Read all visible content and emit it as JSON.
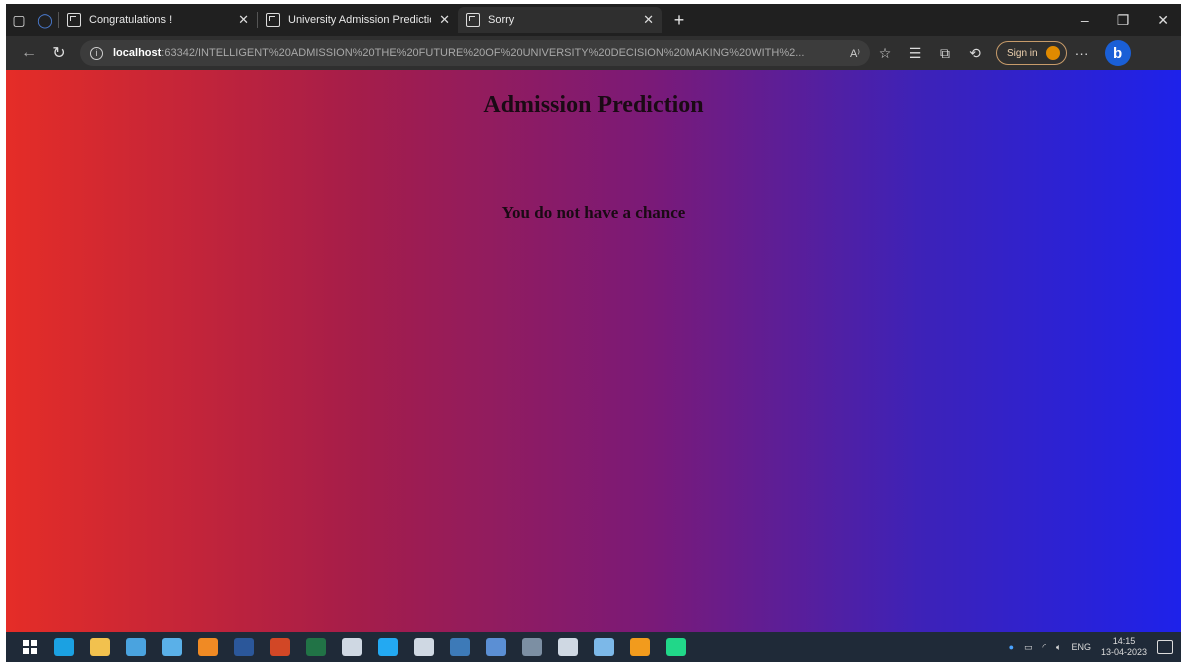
{
  "browser": {
    "tabs": [
      {
        "label": "Congratulations !",
        "active": false
      },
      {
        "label": "University Admission Prediction",
        "active": false
      },
      {
        "label": "Sorry",
        "active": true
      }
    ],
    "url_host": "localhost",
    "url_rest": ":63342/INTELLIGENT%20ADMISSION%20THE%20FUTURE%20OF%20UNIVERSITY%20DECISION%20MAKING%20WITH%2...",
    "read_aloud": "A⁾",
    "signin_label": "Sign in",
    "bing_label": "b"
  },
  "page": {
    "title": "Admission Prediction",
    "result": "You do not have a chance"
  },
  "taskbar": {
    "language": "ENG",
    "time": "14:15",
    "date": "13-04-2023",
    "apps": [
      {
        "name": "windows-start-icon",
        "color": "#ffffff"
      },
      {
        "name": "edge-icon",
        "color": "#1ba1e2"
      },
      {
        "name": "file-explorer-icon",
        "color": "#f2c14e"
      },
      {
        "name": "microsoft-store-icon",
        "color": "#4aa3df"
      },
      {
        "name": "mail-icon",
        "color": "#5ab0e8"
      },
      {
        "name": "vlc-icon",
        "color": "#f08a24"
      },
      {
        "name": "word-icon",
        "color": "#2b579a"
      },
      {
        "name": "powerpoint-icon",
        "color": "#d24726"
      },
      {
        "name": "excel-icon",
        "color": "#217346"
      },
      {
        "name": "settings-icon",
        "color": "#cfd8e3"
      },
      {
        "name": "vscode-icon",
        "color": "#23a9f2"
      },
      {
        "name": "package-icon",
        "color": "#cfd8e3"
      },
      {
        "name": "python-installer-icon",
        "color": "#3d7ab8"
      },
      {
        "name": "python-idle-icon",
        "color": "#5b8fd4"
      },
      {
        "name": "anaconda-icon",
        "color": "#7c8fa3"
      },
      {
        "name": "terminal-icon",
        "color": "#cfd8e3"
      },
      {
        "name": "notepad-icon",
        "color": "#7cb8e8"
      },
      {
        "name": "sublime-icon",
        "color": "#f29b1d"
      },
      {
        "name": "pycharm-icon",
        "color": "#21d789"
      }
    ]
  }
}
